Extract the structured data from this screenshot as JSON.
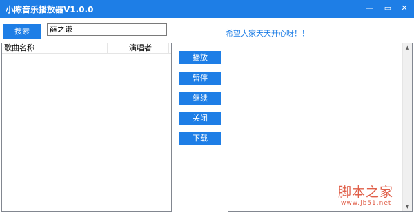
{
  "window": {
    "title": "小陈音乐播放器V1.0.0",
    "min_glyph": "—",
    "max_glyph": "▭",
    "close_glyph": "✕"
  },
  "search": {
    "button_label": "搜索",
    "input_value": "薛之谦"
  },
  "song_list": {
    "columns": [
      "歌曲名称",
      "演唱者"
    ],
    "rows": []
  },
  "controls": {
    "play": "播放",
    "pause": "暂停",
    "resume": "继续",
    "close": "关闭",
    "download": "下载"
  },
  "hint_text": "希望大家天天开心呀！！",
  "scrollbar": {
    "up_glyph": "▲",
    "down_glyph": "▼"
  },
  "watermark": {
    "main": "脚本之家",
    "sub": "www.jb51.net"
  },
  "colors": {
    "accent": "#1e7ee6",
    "watermark": "#e0604a"
  }
}
